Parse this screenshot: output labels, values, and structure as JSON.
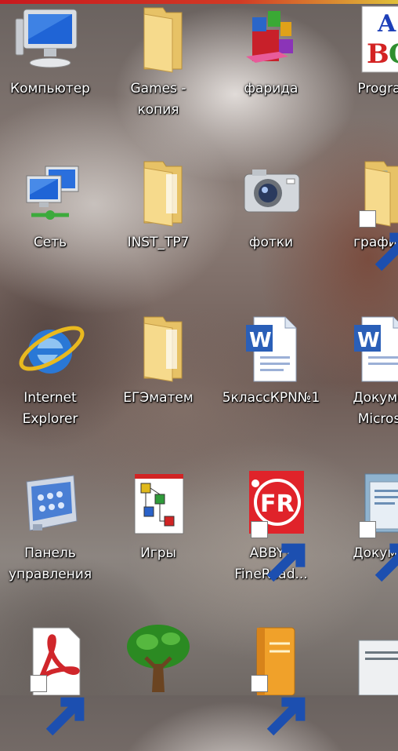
{
  "desktop": {
    "icons": [
      {
        "label": "Компьютер",
        "icon": "computer-icon"
      },
      {
        "label": "Games -\nкопия",
        "icon": "folder-icon"
      },
      {
        "label": "фарида",
        "icon": "office-app-icon"
      },
      {
        "label": "Progra",
        "icon": "abc-program-icon"
      },
      {
        "label": "Сеть",
        "icon": "network-icon"
      },
      {
        "label": "INST_TP7",
        "icon": "folder-icon"
      },
      {
        "label": "фотки",
        "icon": "camera-icon"
      },
      {
        "label": "графич",
        "icon": "folder-shortcut-icon"
      },
      {
        "label": "Internet\nExplorer",
        "icon": "internet-explorer-icon"
      },
      {
        "label": "ЕГЭматем",
        "icon": "folder-icon"
      },
      {
        "label": "5классКРN№1",
        "icon": "word-document-icon"
      },
      {
        "label": "Докуме\nMicros",
        "icon": "word-document-icon"
      },
      {
        "label": "Панель\nуправления",
        "icon": "control-panel-icon"
      },
      {
        "label": "Игры",
        "icon": "games-icon"
      },
      {
        "label": "ABBYY\nFineRead...",
        "icon": "abbyy-finereader-icon"
      },
      {
        "label": "Докуме",
        "icon": "documents-library-icon"
      },
      {
        "label": "",
        "icon": "acrobat-icon"
      },
      {
        "label": "",
        "icon": "tree-icon"
      },
      {
        "label": "",
        "icon": "book-icon"
      },
      {
        "label": "",
        "icon": "document-thumbnail-icon"
      }
    ]
  }
}
